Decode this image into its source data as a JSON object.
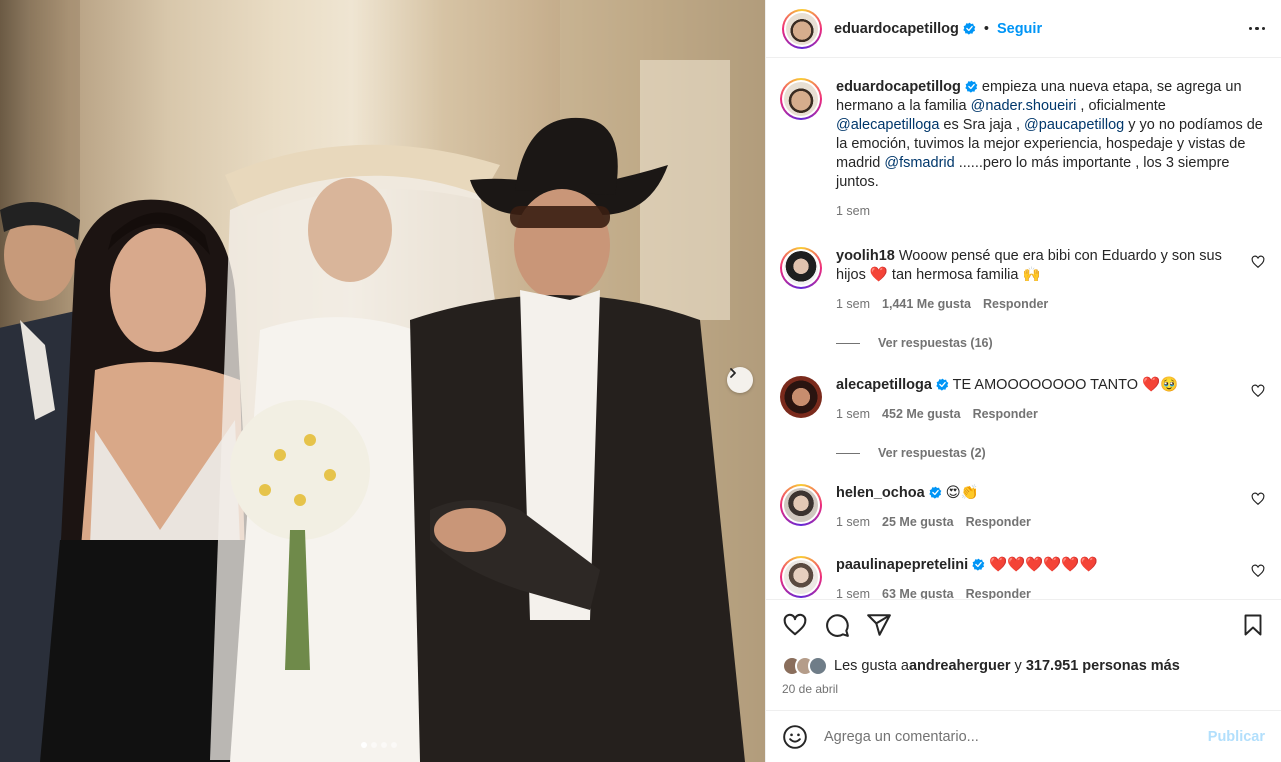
{
  "header": {
    "username": "eduardocapetillog",
    "separator": "•",
    "follow_label": "Seguir",
    "more_icon": "more-horizontal-icon"
  },
  "caption": {
    "username": "eduardocapetillog",
    "text_1": " empieza una nueva etapa, se agrega un hermano a la familia ",
    "mention_1": "@nader.shoueiri",
    "text_2": " , oficialmente ",
    "mention_2": "@alecapetilloga",
    "text_3": " es Sra jaja , ",
    "mention_3": "@paucapetillog",
    "text_4": " y yo no podíamos de la emoción, tuvimos la mejor experiencia, hospedaje y vistas de madrid ",
    "mention_4": "@fsmadrid",
    "text_5": " ......pero lo más importante , los 3 siempre juntos.",
    "time": "1 sem"
  },
  "comments": [
    {
      "username": "yoolih18",
      "verified": false,
      "text": " Wooow pensé que era bibi con Eduardo y son sus hijos ❤️ tan hermosa familia 🙌",
      "time": "1 sem",
      "likes": "1,441 Me gusta",
      "reply": "Responder",
      "replies": "Ver respuestas (16)",
      "avatar_color": "#2b2b2b"
    },
    {
      "username": "alecapetilloga",
      "verified": true,
      "text": " TE AMOOOOOOOO TANTO ❤️🥹",
      "time": "1 sem",
      "likes": "452 Me gusta",
      "reply": "Responder",
      "replies": "Ver respuestas (2)",
      "avatar_color": "#7a2a1c"
    },
    {
      "username": "helen_ochoa",
      "verified": true,
      "text": " 😍👏",
      "time": "1 sem",
      "likes": "25 Me gusta",
      "reply": "Responder",
      "avatar_color": "#cfc7bf"
    },
    {
      "username": "paaulinapepretelini",
      "verified": true,
      "text": " ❤️❤️❤️❤️❤️❤️",
      "time": "1 sem",
      "likes": "63 Me gusta",
      "reply": "Responder",
      "avatar_color": "#d9d4cf"
    }
  ],
  "actions": {
    "icons": [
      "heart-icon",
      "comment-icon",
      "share-icon",
      "bookmark-icon"
    ],
    "likes_prefix": "Les gusta a ",
    "likes_user": "andreaherguer",
    "likes_mid": " y ",
    "likes_count": "317.951 personas más",
    "date": "20 de abril"
  },
  "composer": {
    "placeholder": "Agrega un comentario...",
    "publish_label": "Publicar",
    "emoji_icon": "smiley-icon"
  },
  "colors": {
    "accent": "#0095f6",
    "verified": "#0095f6",
    "publish_disabled": "#b2dffc"
  }
}
